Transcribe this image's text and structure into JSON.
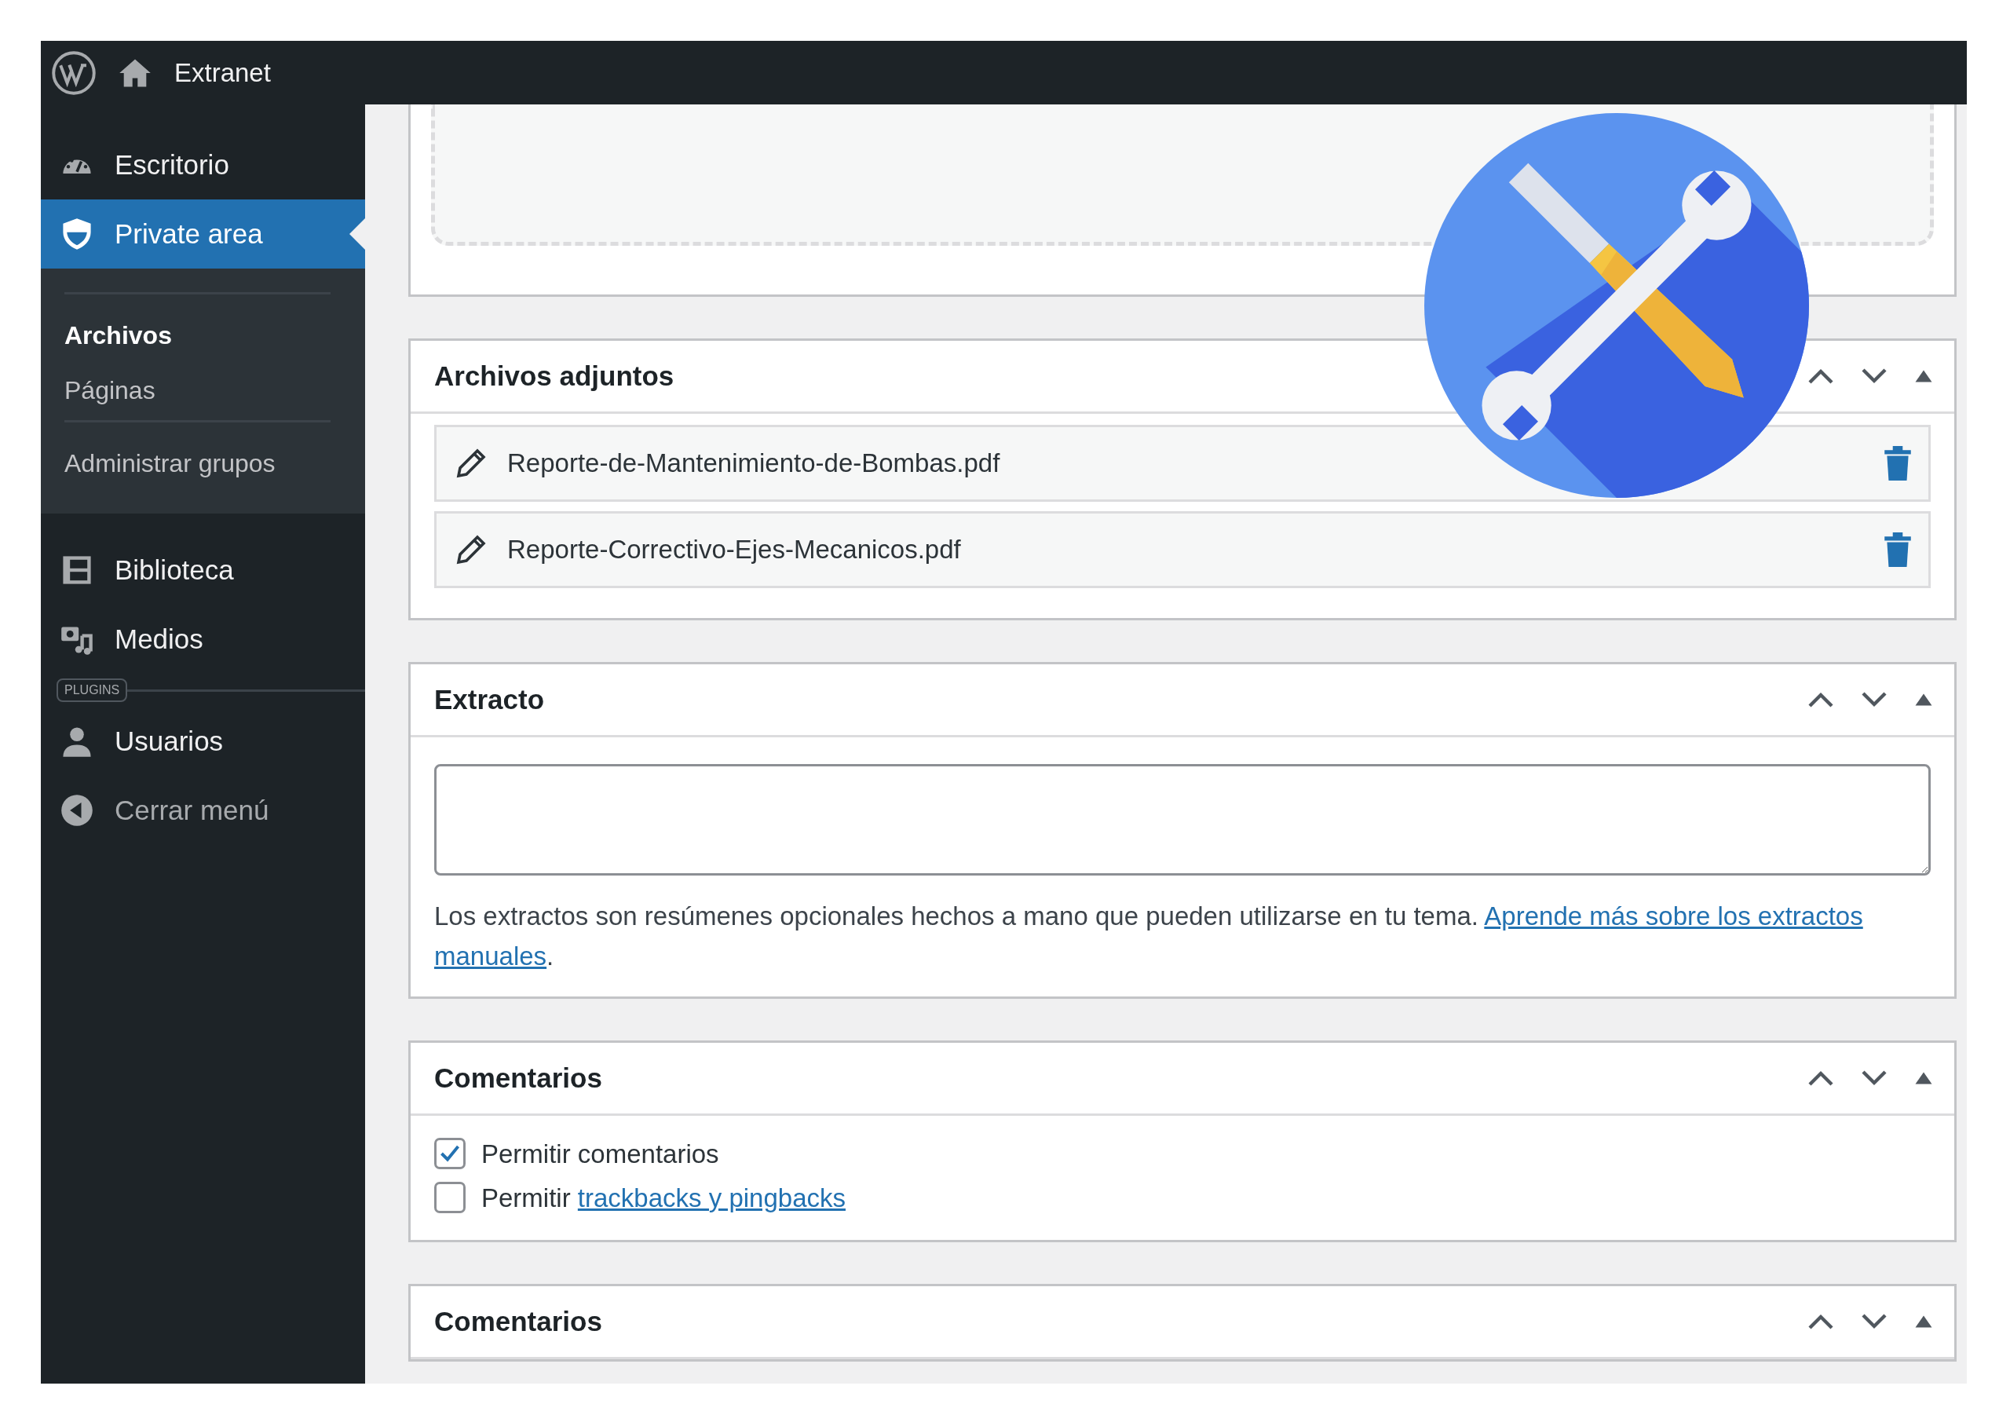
{
  "topbar": {
    "site": "Extranet"
  },
  "sidebar": {
    "groups": [
      {
        "items": [
          {
            "label": "Escritorio",
            "selected": false
          },
          {
            "label": "Private area",
            "selected": true,
            "submenu": [
              [
                {
                  "label": "Archivos",
                  "selected": true
                },
                {
                  "label": "Páginas",
                  "selected": false
                }
              ],
              [
                {
                  "label": "Administrar grupos",
                  "selected": false
                }
              ]
            ]
          },
          {
            "label": "Biblioteca",
            "selected": false
          },
          {
            "label": "Medios",
            "selected": false
          }
        ]
      },
      {
        "badge": "PLUGINS",
        "items": [
          {
            "label": "Usuarios",
            "selected": false
          }
        ]
      }
    ],
    "collapse_label": "Cerrar menú"
  },
  "panels": [
    {
      "kind": "dropzone"
    },
    {
      "kind": "attachments",
      "title": "Archivos adjuntos",
      "files": [
        {
          "name": "Reporte-de-Mantenimiento-de-Bombas.pdf"
        },
        {
          "name": "Reporte-Correctivo-Ejes-Mecanicos.pdf"
        }
      ]
    },
    {
      "kind": "excerpt",
      "title": "Extracto",
      "help": "Los extractos son resúmenes opcionales hechos a mano que pueden utilizarse en tu tema.",
      "link_lines": [
        "Aprende más sobre los extractos",
        "manuales"
      ],
      "after": "."
    },
    {
      "kind": "comments",
      "title": "Comentarios",
      "options": [
        {
          "label": "Permitir comentarios",
          "checked": true
        },
        {
          "label": "Permitir",
          "link": "trackbacks y pingbacks",
          "checked": false
        }
      ]
    },
    {
      "kind": "comments",
      "title": "Comentarios"
    }
  ]
}
